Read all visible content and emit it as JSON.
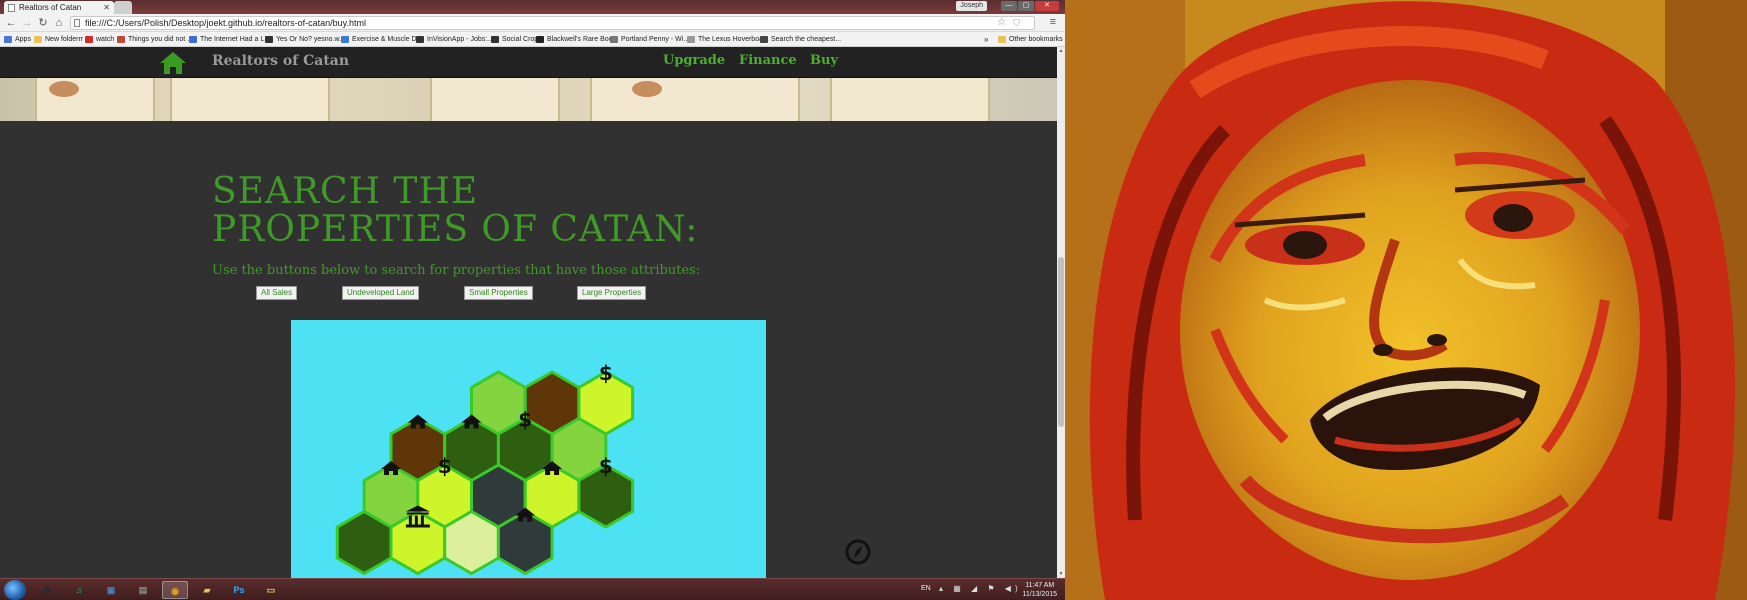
{
  "browser": {
    "tab_title": "Realtors of Catan",
    "user_name": "Joseph",
    "url": "file:///C:/Users/Polish/Desktop/joekt.github.io/realtors-of-catan/buy.html",
    "bookmarks": [
      {
        "label": "Apps",
        "icon_color": "#4a74d6"
      },
      {
        "label": "New folderrr",
        "icon_color": "#e8c25a"
      },
      {
        "label": "watch",
        "icon_color": "#d62b2b"
      },
      {
        "label": "Things you did not ...",
        "icon_color": "#c0483a"
      },
      {
        "label": "The Internet Had a L...",
        "icon_color": "#3a6fd8"
      },
      {
        "label": "Yes Or No? yesno.w...",
        "icon_color": "#333333"
      },
      {
        "label": "Exercise & Muscle D...",
        "icon_color": "#3a7bd5"
      },
      {
        "label": "InVisionApp - Jobs:...",
        "icon_color": "#333333"
      },
      {
        "label": "Social Crop",
        "icon_color": "#333333"
      },
      {
        "label": "Blackwell's Rare Boo...",
        "icon_color": "#222222"
      },
      {
        "label": "Portland Penny - Wi...",
        "icon_color": "#777777"
      },
      {
        "label": "The Lexus Hoverboa...",
        "icon_color": "#999999"
      },
      {
        "label": "Search the cheapest...",
        "icon_color": "#444444"
      }
    ],
    "bookmarks_overflow": "»",
    "other_bookmarks": "Other bookmarks"
  },
  "site": {
    "title": "Realtors of Catan",
    "nav": [
      "Upgrade",
      "Finance",
      "Buy"
    ],
    "heading": "Search the properties of Catan:",
    "subheading": "Use the buttons below to search for properties that have those attributes:",
    "filters": [
      "All Sales",
      "Undeveloped Land",
      "Small Properties",
      "Large Properties"
    ],
    "brand_color": "#3f9a27"
  },
  "map": {
    "background": "#4ce2f3",
    "tile_colors": {
      "light": "#84d440",
      "brown": "#5e3608",
      "lime": "#cdf52a",
      "dark": "#2e5e0f",
      "slate": "#2f3b3b",
      "pale": "#dcef9a"
    },
    "tiles": [
      {
        "col": 2,
        "row": 0,
        "fill": "light"
      },
      {
        "col": 3,
        "row": 0,
        "fill": "brown"
      },
      {
        "col": 4,
        "row": 0,
        "fill": "lime",
        "marker": "$"
      },
      {
        "col": 1,
        "row": 1,
        "fill": "brown",
        "marker": "house"
      },
      {
        "col": 2,
        "row": 1,
        "fill": "dark",
        "marker": "house"
      },
      {
        "col": 3,
        "row": 1,
        "fill": "dark",
        "marker": "$"
      },
      {
        "col": 4,
        "row": 1,
        "fill": "light"
      },
      {
        "col": 0,
        "row": 2,
        "fill": "light",
        "marker": "house"
      },
      {
        "col": 1,
        "row": 2,
        "fill": "lime",
        "marker": "$"
      },
      {
        "col": 2,
        "row": 2,
        "fill": "slate"
      },
      {
        "col": 3,
        "row": 2,
        "fill": "lime",
        "marker": "house"
      },
      {
        "col": 4,
        "row": 2,
        "fill": "dark",
        "marker": "$"
      },
      {
        "col": 0,
        "row": 3,
        "fill": "dark"
      },
      {
        "col": 1,
        "row": 3,
        "fill": "lime",
        "marker": "bank"
      },
      {
        "col": 2,
        "row": 3,
        "fill": "pale"
      },
      {
        "col": 3,
        "row": 3,
        "fill": "slate",
        "marker": "house"
      }
    ]
  },
  "taskbar": {
    "apps": [
      {
        "name": "steam-icon",
        "glyph": "⚙",
        "color": "#1b2838"
      },
      {
        "name": "spotify-icon",
        "glyph": "♫",
        "color": "#1db954"
      },
      {
        "name": "computer-icon",
        "glyph": "▣",
        "color": "#4a7fb8"
      },
      {
        "name": "files-icon",
        "glyph": "▤",
        "color": "#8a8a8a"
      },
      {
        "name": "chrome-icon",
        "glyph": "◉",
        "color": "#e0a21b",
        "active": true
      },
      {
        "name": "explorer-icon",
        "glyph": "▰",
        "color": "#e8c25a"
      },
      {
        "name": "photoshop-icon",
        "glyph": "Ps",
        "color": "#0f2a4a"
      },
      {
        "name": "folder-icon",
        "glyph": "▭",
        "color": "#e8c25a"
      }
    ],
    "language": "EN",
    "time": "11:47 AM",
    "date": "11/13/2015"
  }
}
